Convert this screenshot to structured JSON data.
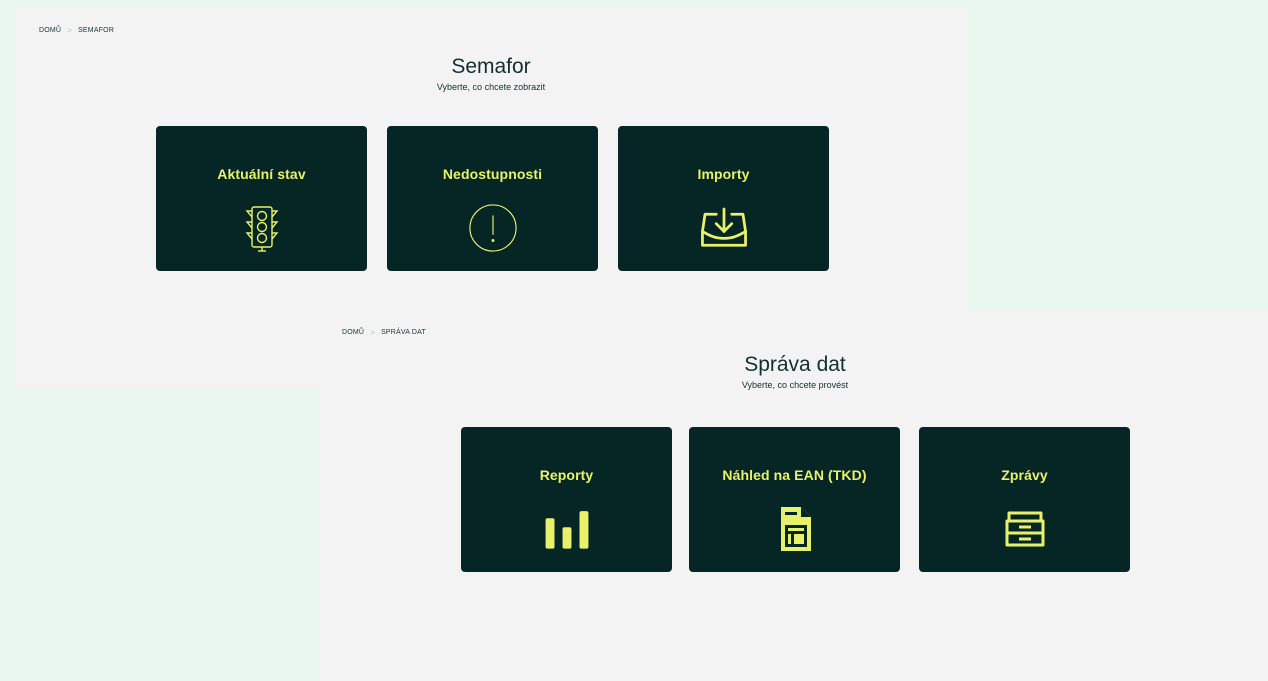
{
  "colors": {
    "outer_background": "#e9f7f0",
    "panel_background": "#f3f3f3",
    "card_background": "#052624",
    "card_accent": "#e9f16b",
    "text_dark": "#13302f",
    "breadcrumb_separator": "#9ad3a9"
  },
  "semafor": {
    "breadcrumb": {
      "home": "DOMŮ",
      "separator": ">",
      "current": "SEMAFOR"
    },
    "title": "Semafor",
    "subtitle": "Vyberte, co chcete zobrazit",
    "cards": [
      {
        "label": "Aktuální stav",
        "icon": "traffic-light-icon"
      },
      {
        "label": "Nedostupnosti",
        "icon": "exclamation-circle-icon"
      },
      {
        "label": "Importy",
        "icon": "import-download-icon"
      }
    ]
  },
  "sprava": {
    "breadcrumb": {
      "home": "DOMŮ",
      "separator": ">",
      "current": "SPRÁVA DAT"
    },
    "title": "Správa dat",
    "subtitle": "Vyberte, co chcete provést",
    "cards": [
      {
        "label": "Reporty",
        "icon": "bar-chart-icon"
      },
      {
        "label": "Náhled na EAN (TKD)",
        "icon": "document-table-icon"
      },
      {
        "label": "Zprávy",
        "icon": "inbox-tray-icon"
      }
    ]
  }
}
